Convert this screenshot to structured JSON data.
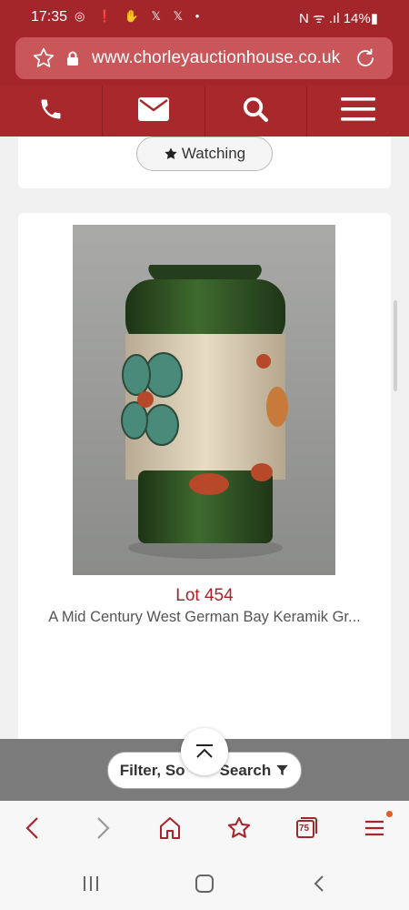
{
  "status_bar": {
    "time": "17:35",
    "notifications": "◎ ❗ ✋ 𝕏 𝕏 •",
    "right": "N ᯤ .ıl 14%▮"
  },
  "browser": {
    "url": "www.chorleyauctionhouse.co.uk"
  },
  "nav": {
    "items": [
      "phone-icon",
      "mail-icon",
      "search-icon",
      "menu-icon"
    ]
  },
  "watch_button": {
    "label": "Watching"
  },
  "lot": {
    "number": "Lot 454",
    "description": "A Mid Century West German Bay Keramik Gr..."
  },
  "filter": {
    "label": "Filter, So",
    "label_tail": "Search"
  },
  "browser_toolbar": {
    "tab_count": "75"
  },
  "colors": {
    "brand": "#a5262a",
    "url_bar": "#c9575a",
    "lot_text": "#a5262a"
  }
}
